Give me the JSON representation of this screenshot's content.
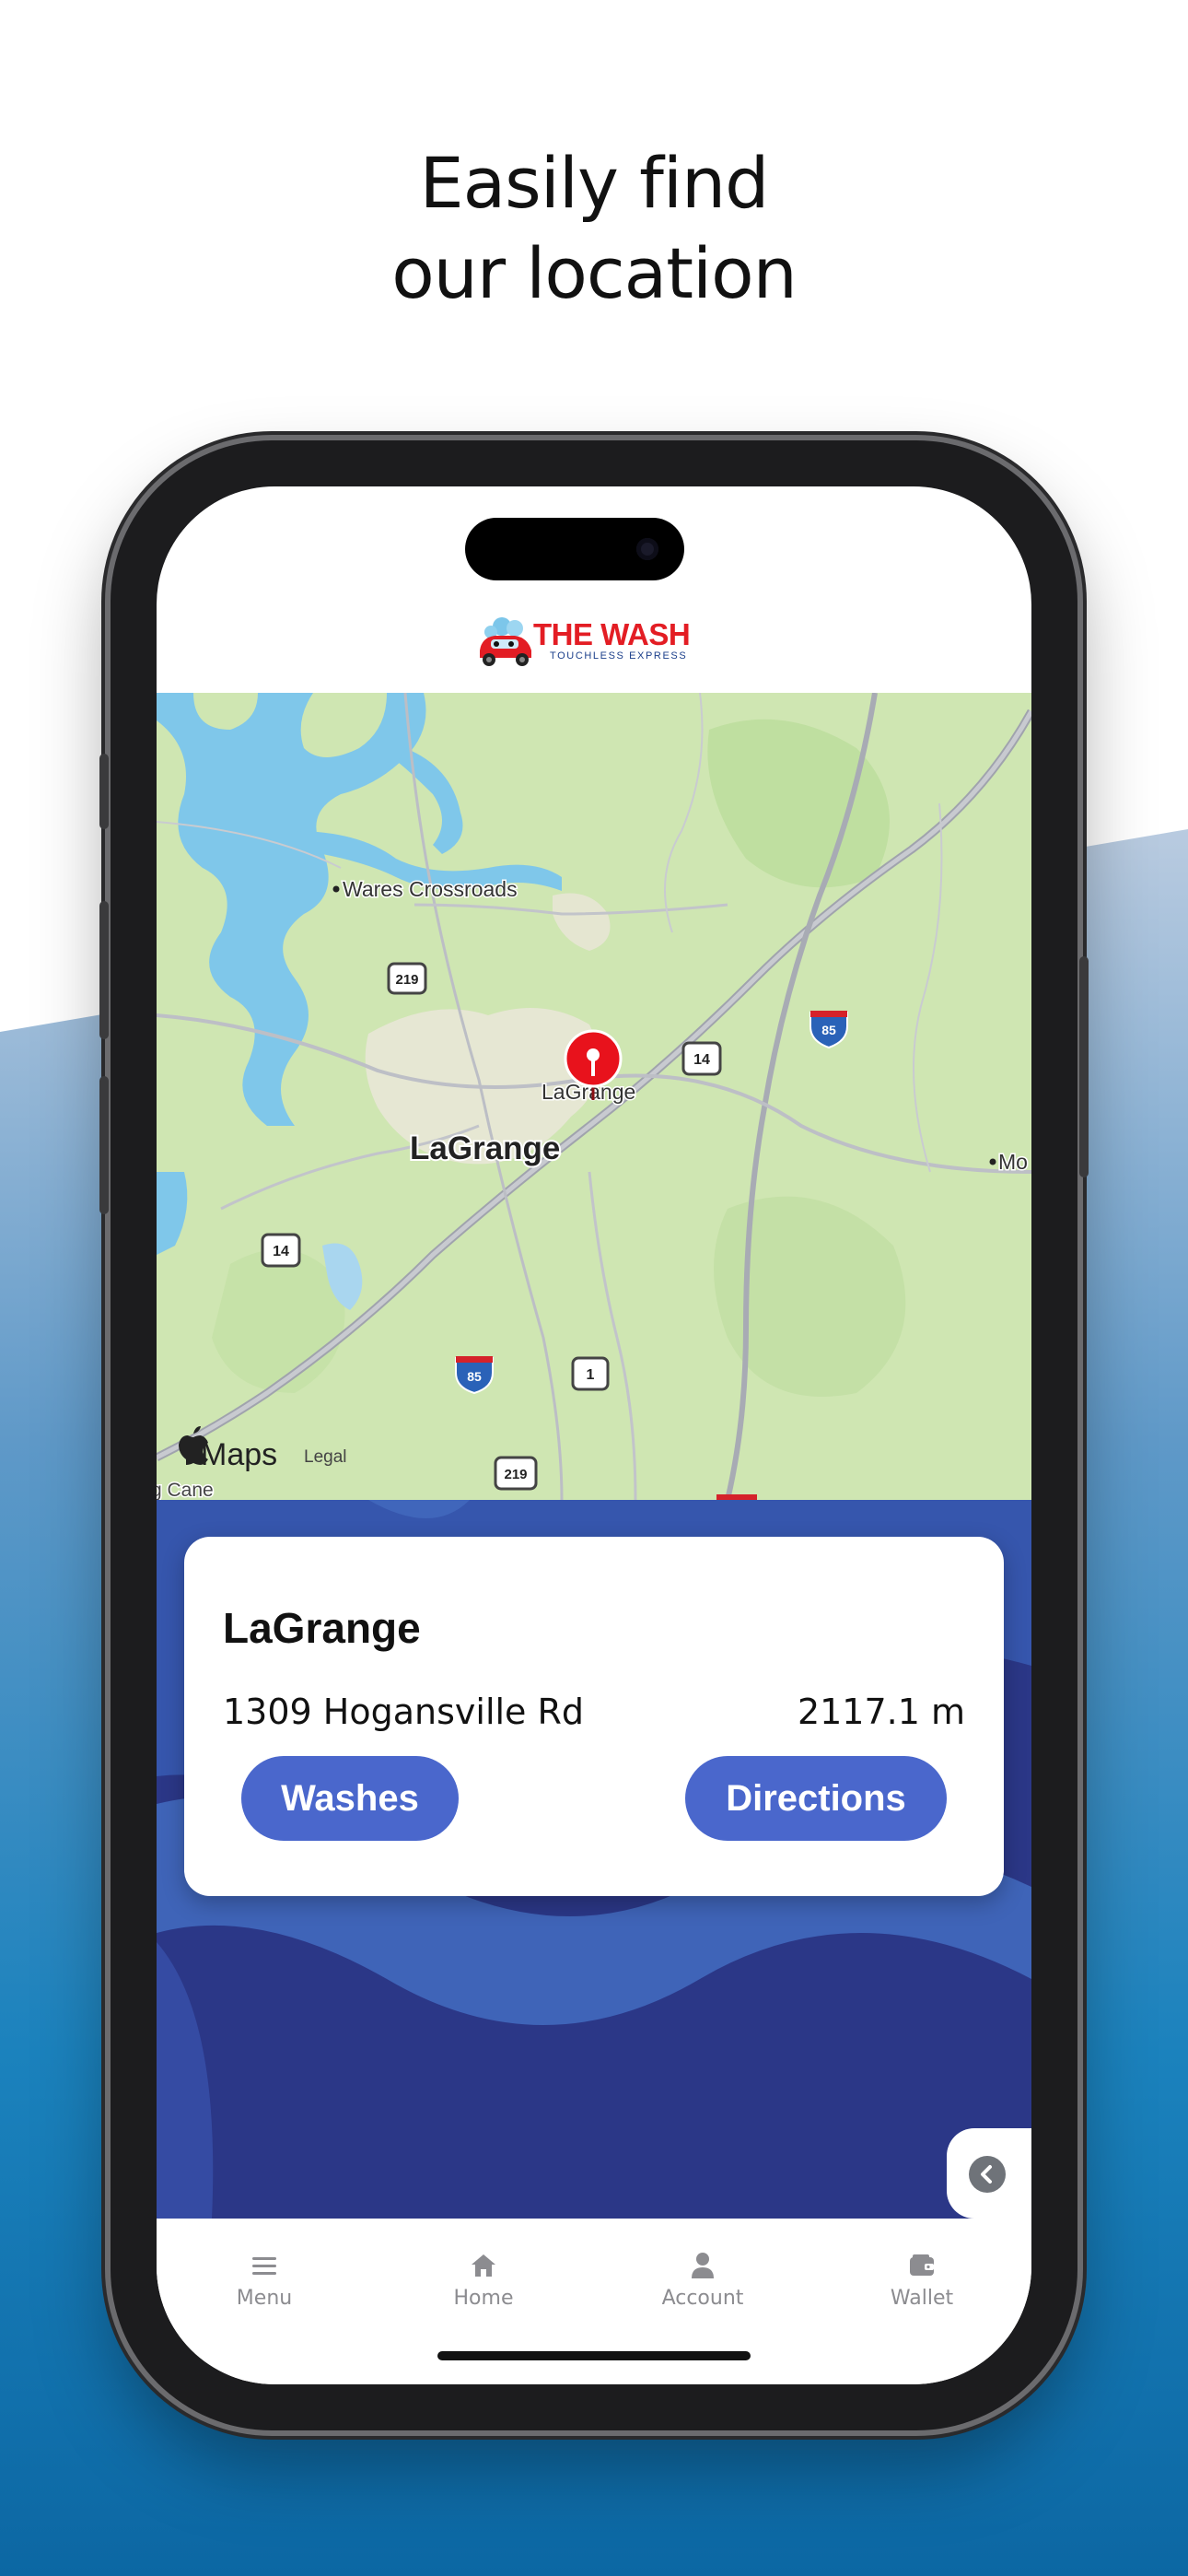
{
  "promo": {
    "headline_line1": "Easily find",
    "headline_line2": "our location"
  },
  "app": {
    "brand_name": "THE WASH",
    "brand_tagline": "TOUCHLESS EXPRESS"
  },
  "map": {
    "place_labels": [
      "Wares Crossroads",
      "LaGrange",
      "LaGrange",
      "Mo",
      "g Cane"
    ],
    "route_shields": [
      "219",
      "14",
      "85",
      "14",
      "85",
      "1",
      "219"
    ],
    "provider": "Maps",
    "legal": "Legal"
  },
  "location_card": {
    "name": "LaGrange",
    "address": "1309 Hogansville Rd",
    "distance": "2117.1 m",
    "washes_label": "Washes",
    "directions_label": "Directions"
  },
  "tabbar": {
    "items": [
      {
        "label": "Menu",
        "icon": "menu-icon"
      },
      {
        "label": "Home",
        "icon": "home-icon"
      },
      {
        "label": "Account",
        "icon": "account-icon"
      },
      {
        "label": "Wallet",
        "icon": "wallet-icon"
      }
    ]
  },
  "colors": {
    "brand_red": "#e31d24",
    "accent_blue": "#4a67cc",
    "panel_navy": "#2b3886",
    "pin_red": "#e8121c"
  }
}
